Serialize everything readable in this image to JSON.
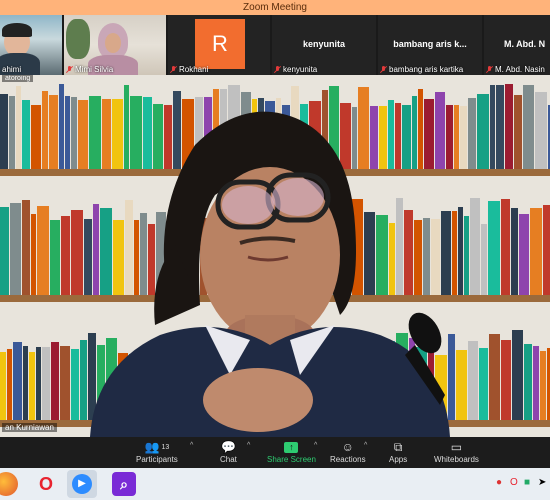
{
  "window": {
    "title": "Zoom Meeting"
  },
  "participants": [
    {
      "name": "ahimi"
    },
    {
      "name": "Mimi Silvia"
    },
    {
      "name": "Rokhani",
      "initial": "R"
    },
    {
      "name": "kenyunita",
      "display": "kenyunita"
    },
    {
      "name": "bambang aris kartika",
      "display": "bambang aris k..."
    },
    {
      "name": "M. Abd. Nasin",
      "display": "M. Abd. N"
    }
  ],
  "speaker": {
    "name": "an Kurniawan",
    "top_label": "atoroing"
  },
  "toolbar": {
    "participants": {
      "label": "Participants",
      "count": "13"
    },
    "chat": {
      "label": "Chat"
    },
    "share": {
      "label": "Share Screen"
    },
    "reactions": {
      "label": "Reactions"
    },
    "apps": {
      "label": "Apps"
    },
    "whiteboards": {
      "label": "Whiteboards"
    }
  },
  "colors": {
    "accent": "#2ecc71",
    "titlebar": "#ffb37a",
    "avatar": "#f26d2f"
  },
  "taskbar": {
    "icons": [
      "firefox-icon",
      "opera-icon",
      "zoom-icon",
      "search-app-icon"
    ]
  }
}
